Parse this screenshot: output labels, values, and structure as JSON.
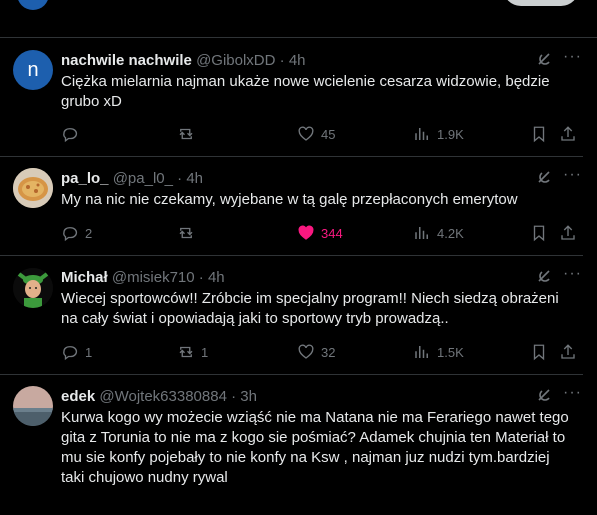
{
  "colors": {
    "background": "#000000",
    "text": "#e7e9ea",
    "muted": "#71767b",
    "like": "#f91880",
    "divider": "#2f3336"
  },
  "tweets": [
    {
      "name": "nachwile nachwile",
      "handle": "@GibolxDD",
      "dot": "·",
      "time": "4h",
      "avatar_letter": "n",
      "text": "Ciężka mielarnia najman ukaże nowe wcielenie cesarza widzowie, będzie grubo xD",
      "replies": "",
      "reposts": "",
      "likes": "45",
      "views": "1.9K",
      "liked": false
    },
    {
      "name": "pa_lo_",
      "handle": "@pa_l0_",
      "dot": "·",
      "time": "4h",
      "text": "My na nic nie czekamy, wyjebane w tą galę przepłaconych emerytow",
      "replies": "2",
      "reposts": "",
      "likes": "344",
      "views": "4.2K",
      "liked": true
    },
    {
      "name": "Michał",
      "handle": "@misiek710",
      "dot": "·",
      "time": "4h",
      "text": "Wiecej sportowców!! Zróbcie im specjalny program!! Niech siedzą obrażeni na cały świat i opowiadają jaki to sportowy tryb prowadzą..",
      "replies": "1",
      "reposts": "1",
      "likes": "32",
      "views": "1.5K",
      "liked": false
    },
    {
      "name": "edek",
      "handle": "@Wojtek63380884",
      "dot": "·",
      "time": "3h",
      "text": "Kurwa kogo wy możecie wziąść nie ma Natana nie ma Ferariego nawet tego gita z Torunia to nie ma z kogo sie pośmiać? Adamek chujnia ten Materiał to mu sie konfy pojebały to nie konfy na Ksw , najman juz nudzi tym.bardziej taki chujowo nudny rywal",
      "replies": "",
      "reposts": "",
      "likes": "",
      "views": "",
      "liked": false
    }
  ],
  "icons": {
    "reply": "reply-icon",
    "repost": "repost-icon",
    "like": "heart-icon",
    "views": "views-icon",
    "bookmark": "bookmark-icon",
    "share": "share-icon",
    "grok": "grok-icon",
    "more": "more-icon"
  }
}
